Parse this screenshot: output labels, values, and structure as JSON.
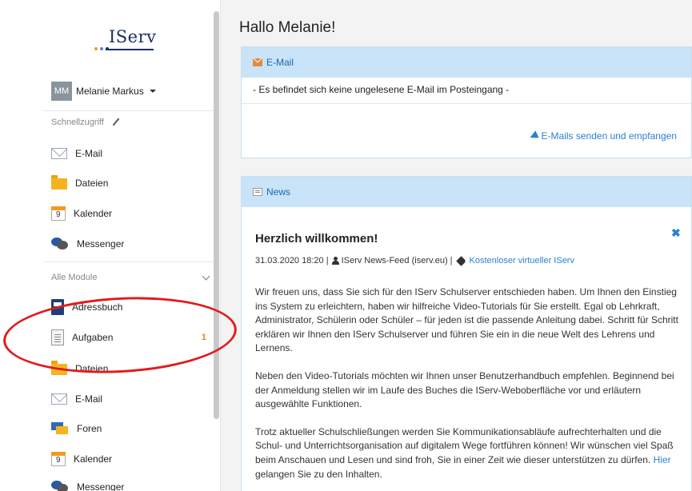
{
  "logo": {
    "text": "IServ",
    "dot_colors": [
      "#f39a1c",
      "#4a8ad4",
      "#1b2d63"
    ]
  },
  "user": {
    "initials": "MM",
    "name": "Melanie Markus"
  },
  "quick_access": {
    "label": "Schnellzugriff",
    "items": [
      {
        "label": "E-Mail",
        "icon": "mail-icon"
      },
      {
        "label": "Dateien",
        "icon": "folder-icon"
      },
      {
        "label": "Kalender",
        "icon": "calendar-icon",
        "icon_text": "9"
      },
      {
        "label": "Messenger",
        "icon": "chat-icon"
      }
    ]
  },
  "all_modules": {
    "label": "Alle Module",
    "items": [
      {
        "label": "Adressbuch",
        "icon": "addressbook-icon"
      },
      {
        "label": "Aufgaben",
        "icon": "tasks-icon",
        "badge": "1"
      },
      {
        "label": "Dateien",
        "icon": "folder-icon"
      },
      {
        "label": "E-Mail",
        "icon": "mail-icon"
      },
      {
        "label": "Foren",
        "icon": "forum-icon"
      },
      {
        "label": "Kalender",
        "icon": "calendar-icon",
        "icon_text": "9"
      },
      {
        "label": "Messenger",
        "icon": "chat-icon"
      }
    ]
  },
  "main": {
    "greeting": "Hallo Melanie!",
    "email_panel": {
      "title": "E-Mail",
      "message": "- Es befindet sich keine ungelesene E-Mail im Posteingang -",
      "link": "E-Mails senden und empfangen"
    },
    "news_panel": {
      "title": "News",
      "article": {
        "headline": "Herzlich willkommen!",
        "date": "31.03.2020 18:20 |",
        "author": "IServ News-Feed (iserv.eu) |",
        "tag": "Kostenloser virtueller IServ",
        "paragraph1": "Wir freuen uns, dass Sie sich für den IServ Schulserver entschieden haben. Um Ihnen den Einstieg ins System zu erleichtern, haben wir hilfreiche Video-Tutorials für Sie erstellt. Egal ob Lehrkraft, Administrator, Schülerin oder Schüler – für jeden ist die passende Anleitung dabei. Schritt für Schritt erklären wir Ihnen den IServ Schulserver und führen Sie ein in die neue Welt des Lehrens und Lernens.",
        "paragraph2": "Neben den Video-Tutorials möchten wir Ihnen unser Benutzerhandbuch empfehlen. Beginnend bei der Anmeldung stellen wir im Laufe des Buches die IServ-Weboberfläche vor und erläutern ausgewählte Funktionen.",
        "paragraph3_text": "Trotz aktueller Schulschließungen werden Sie Kommunikationsabläufe aufrechterhalten und die Schul- und Unterrichtsorganisation auf digitalem Wege fortführen können! Wir wünschen viel Spaß beim Anschauen und Lesen und sind froh, Sie in einer Zeit wie dieser unterstützen zu dürfen.",
        "paragraph3_link": "Hier",
        "paragraph3_end": "gelangen Sie zu den Inhalten."
      }
    }
  },
  "colors": {
    "accent": "#2c7fd1",
    "panel_header": "#c9e4f8",
    "badge": "#e8831a",
    "annotation": "#e3191b"
  }
}
